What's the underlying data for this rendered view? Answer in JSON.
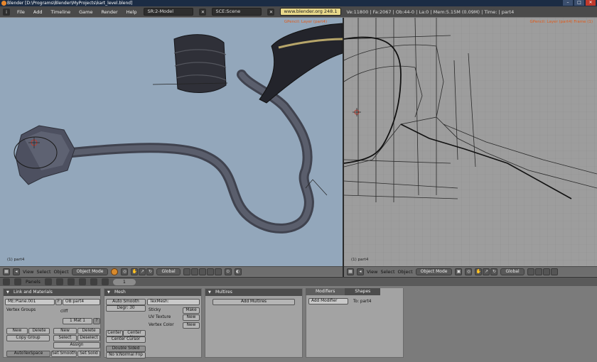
{
  "window": {
    "title": "Blender [D:\\Programs\\Blender\\MyProjects\\kart_level.blend]"
  },
  "topbar": {
    "menus": [
      "File",
      "Add",
      "Timeline",
      "Game",
      "Render",
      "Help"
    ],
    "screen": "SR:2-Model",
    "scene": "SCE:Scene",
    "url": "www.blender.org 248.1",
    "stats": "Ve:11800 | Fa:2067 | Ob:44-0 | La:0 | Mem:5.15M (0.09M) | Time: | part4"
  },
  "viewport_left": {
    "grease_label": "GPencil: Layer (part4)",
    "object_label": "(1) part4"
  },
  "viewport_right": {
    "grease_label": "GPencil: Layer (part4) Frame (1)",
    "object_label": "(1) part4"
  },
  "header_left": {
    "view": "View",
    "select": "Select",
    "object": "Object",
    "mode": "Object Mode",
    "orientation": "Global"
  },
  "header_right": {
    "view": "View",
    "select": "Select",
    "object": "Object",
    "mode": "Object Mode",
    "orientation": "Global"
  },
  "buttons_header": {
    "panels": "Panels",
    "frame": "1"
  },
  "link_panel": {
    "title": "Link and Materials",
    "me_field": "ME:Plane.001",
    "f_btn": "F",
    "ob_field": "OB:part4",
    "vertex_groups": "Vertex Groups",
    "mat_name": "cliff",
    "mat_slot": "1 Mat 1",
    "new1": "New",
    "delete1": "Delete",
    "copy_group": "Copy Group",
    "new2": "New",
    "delete2": "Delete",
    "select": "Select",
    "deselect": "Deselect",
    "assign": "Assign",
    "autotex": "AutoTexSpace",
    "set_smooth": "Set Smooth",
    "set_solid": "Set Solid"
  },
  "mesh_panel": {
    "title": "Mesh",
    "auto_smooth": "Auto Smooth",
    "degr": "Degr: 30",
    "texmesh": "TexMesh:",
    "sticky": "Sticky",
    "make": "Make",
    "uv_texture": "UV Texture",
    "new_uv": "New",
    "vertex_color": "Vertex Color",
    "new_vc": "New",
    "center": "Center",
    "center_new": "Center New",
    "center_cursor": "Center Cursor",
    "double_sided": "Double Sided",
    "no_vnormal": "No V.Normal Flip"
  },
  "multires_panel": {
    "title": "Multires",
    "add_multires": "Add Multires"
  },
  "modifiers_panel": {
    "tab_modifiers": "Modifiers",
    "tab_shapes": "Shapes",
    "add_modifier": "Add Modifier",
    "to": "To: part4"
  }
}
